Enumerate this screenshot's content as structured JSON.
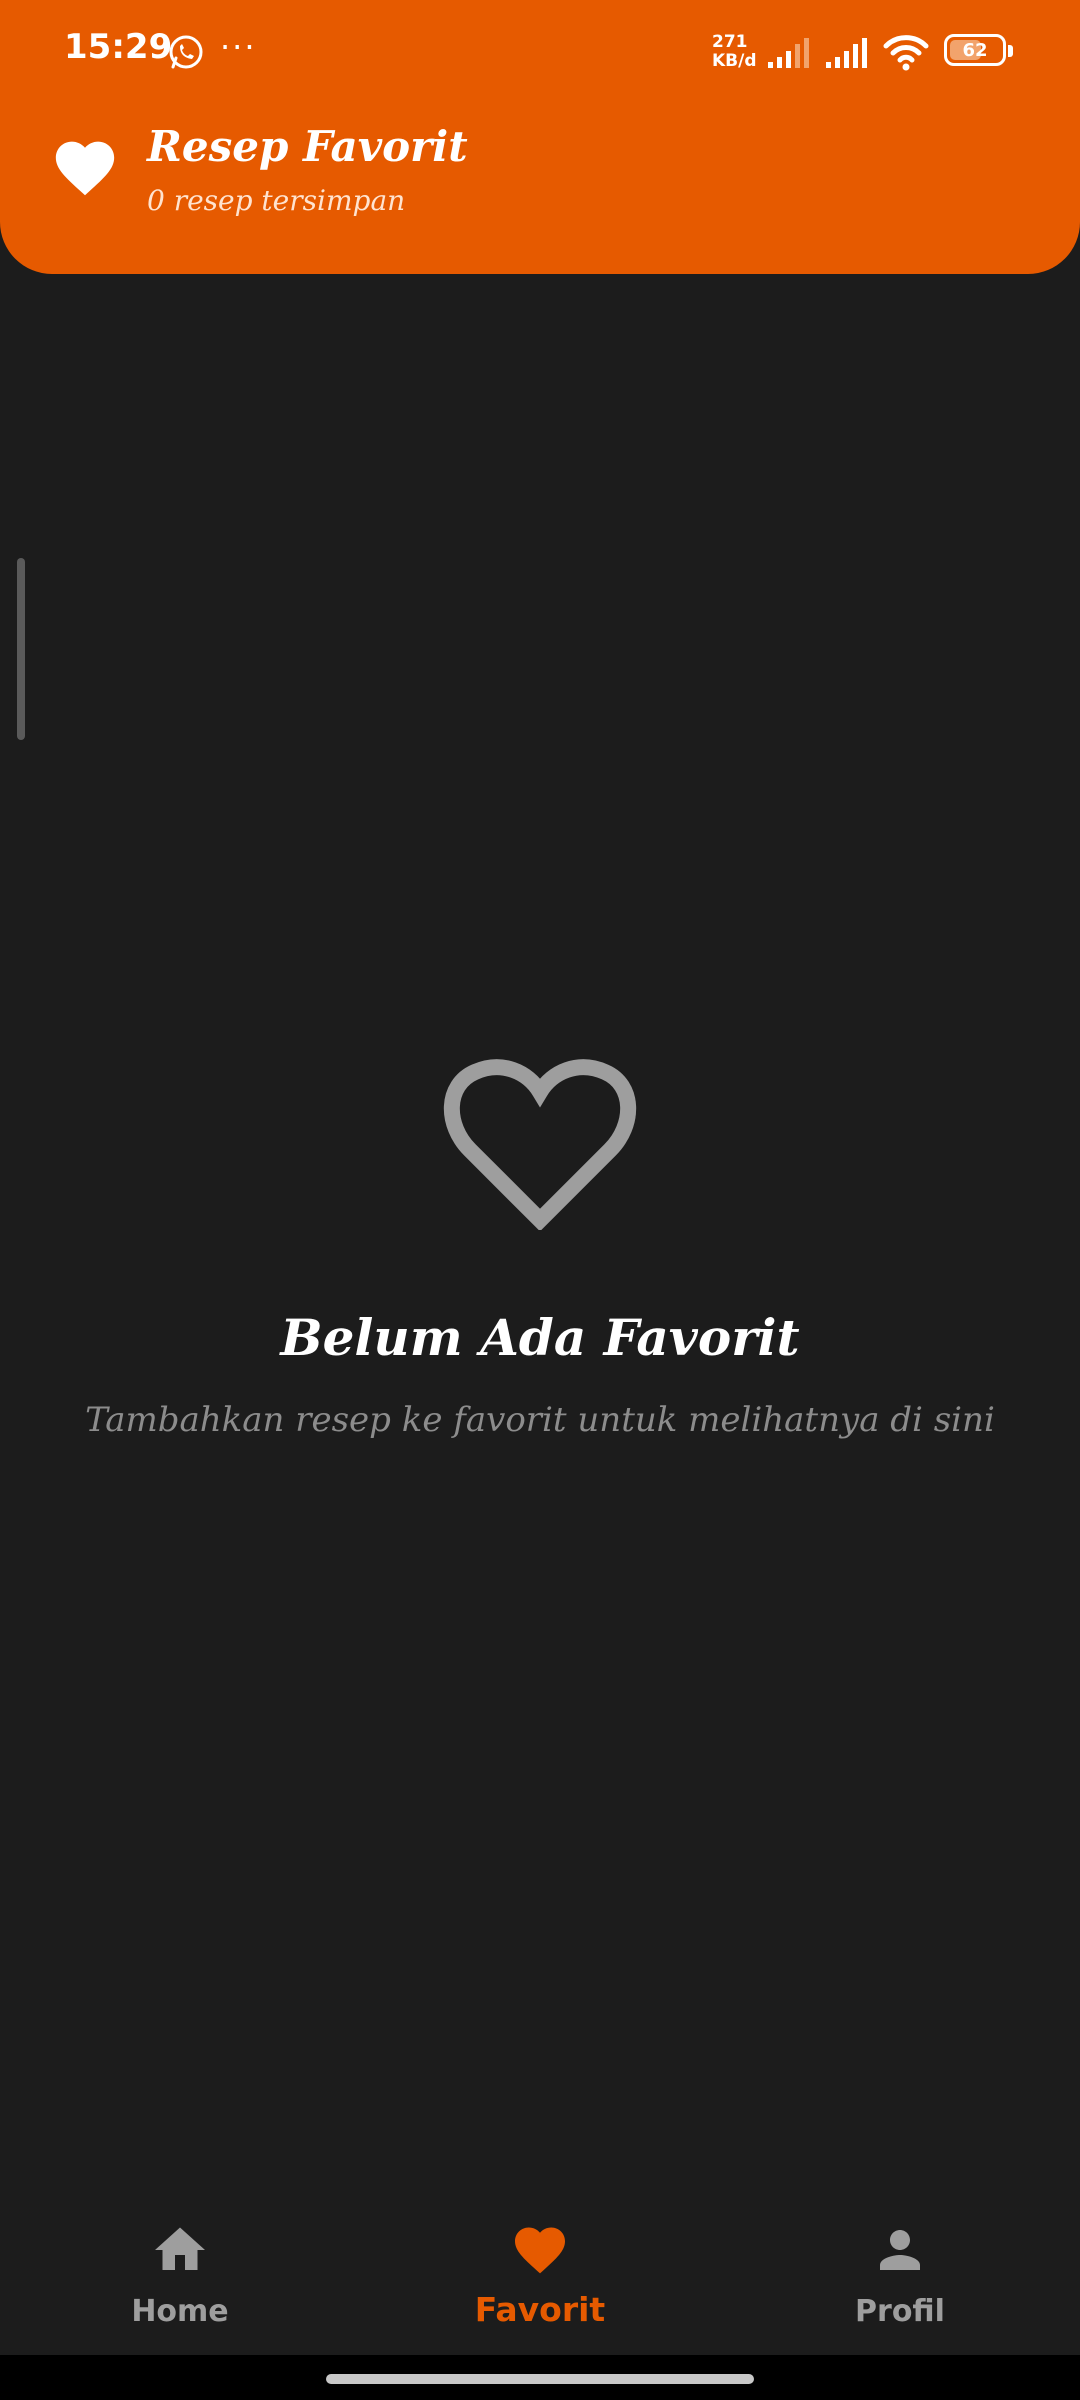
{
  "status_bar": {
    "time": "15:29",
    "more_dots": "···",
    "speed_value": "271",
    "speed_unit": "KB/d",
    "battery_level": "62",
    "battery_fraction": 0.62
  },
  "header": {
    "title": "Resep Favorit",
    "subtitle": "0 resep tersimpan",
    "icon": "heart-icon",
    "background_color": "#e65a00"
  },
  "empty_state": {
    "icon": "heart-outline-icon",
    "title": "Belum Ada Favorit",
    "message": "Tambahkan resep ke favorit untuk melihatnya di sini"
  },
  "bottom_nav": {
    "items": [
      {
        "label": "Home",
        "icon": "home-icon",
        "active": false
      },
      {
        "label": "Favorit",
        "icon": "heart-icon",
        "active": true
      },
      {
        "label": "Profil",
        "icon": "person-icon",
        "active": false
      }
    ],
    "active_color": "#e65a00",
    "inactive_color": "#9e9e9e"
  }
}
